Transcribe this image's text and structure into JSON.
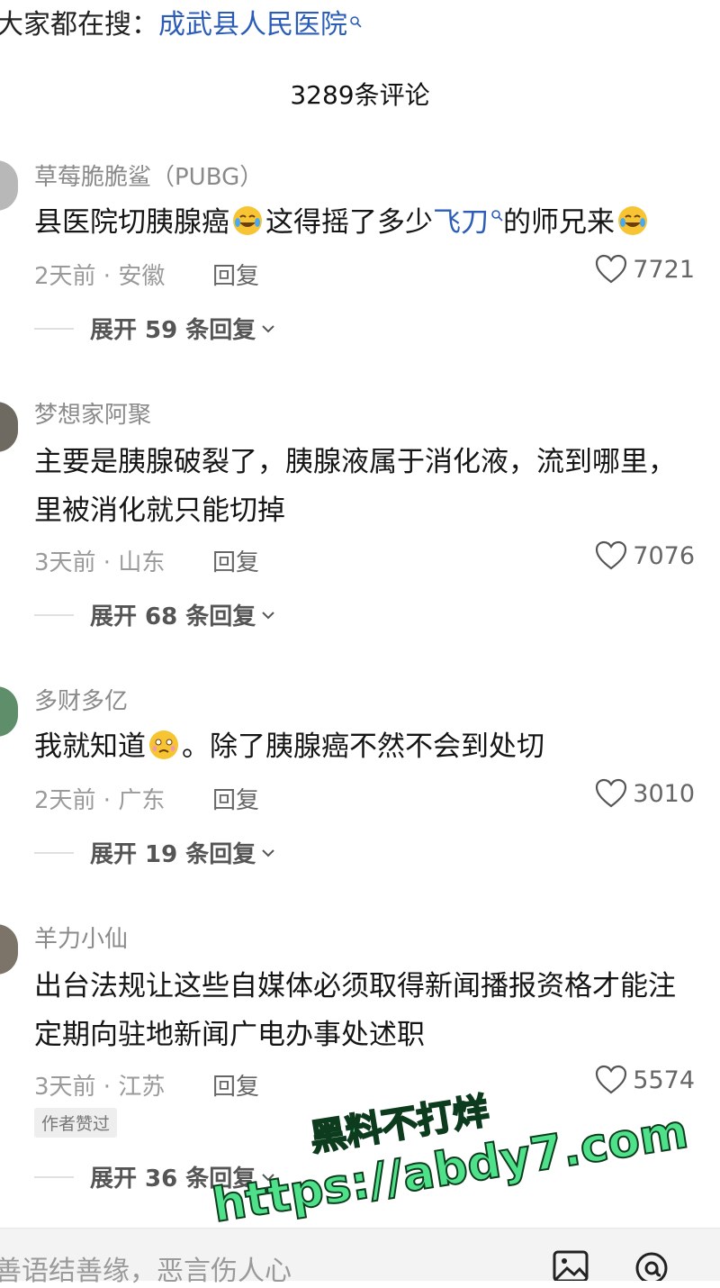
{
  "top_search": {
    "prefix": "大家都在搜：",
    "term": "成武县人民医院"
  },
  "comment_count": "3289条评论",
  "comments": [
    {
      "username": "草莓脆脆鲨（PUBG）",
      "text_parts": [
        "县医院切胰腺癌",
        "这得摇了多少",
        "飞刀",
        "的师兄来"
      ],
      "time": "2天前 · 安徽",
      "reply": "回复",
      "likes": "7721",
      "expand": "展开 59 条回复"
    },
    {
      "username": "梦想家阿聚",
      "line1": "主要是胰腺破裂了，胰腺液属于消化液，流到哪里，",
      "line2": "里被消化就只能切掉",
      "time": "3天前 · 山东",
      "reply": "回复",
      "likes": "7076",
      "expand": "展开 68 条回复"
    },
    {
      "username": "多财多亿",
      "text_parts": [
        "我就知道",
        "。除了胰腺癌不然不会到处切"
      ],
      "time": "2天前 · 广东",
      "reply": "回复",
      "likes": "3010",
      "expand": "展开 19 条回复"
    },
    {
      "username": "羊力小仙",
      "line1": "出台法规让这些自媒体必须取得新闻播报资格才能注",
      "line2": "定期向驻地新闻广电办事处述职",
      "time": "3天前 · 江苏",
      "reply": "回复",
      "likes": "5574",
      "author_badge": "作者赞过",
      "expand": "展开 36 条回复"
    }
  ],
  "watermark": {
    "line1": "黑料不打烊",
    "line2": "https://abdy7.com"
  },
  "input": {
    "placeholder": "善语结善缘，恶言伤人心"
  },
  "colors": {
    "link": "#2b5cb8",
    "watermark": "#4fe08a"
  }
}
